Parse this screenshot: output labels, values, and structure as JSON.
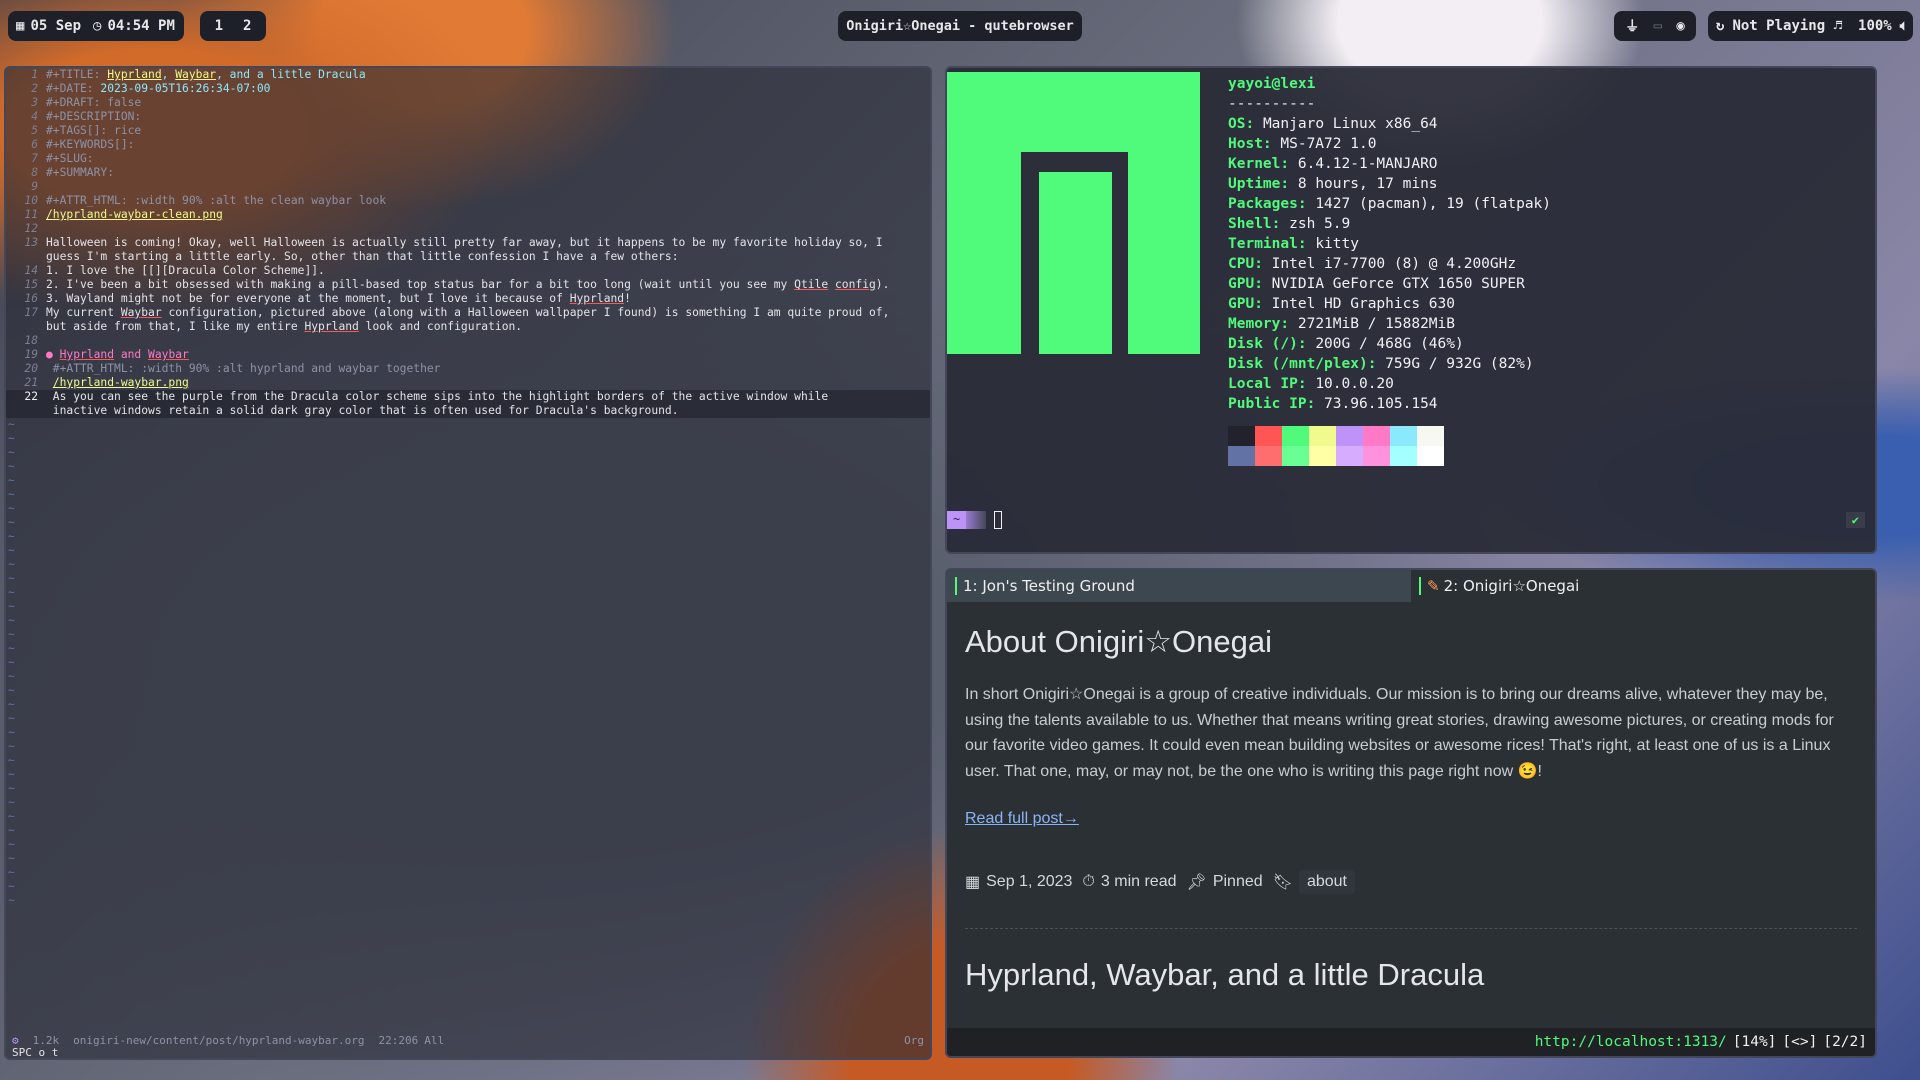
{
  "topbar": {
    "date": "05 Sep",
    "time": "04:54 PM",
    "workspaces": [
      "1",
      "2"
    ],
    "window_title": "Onigiri☆Onegai - qutebrowser",
    "media": "Not Playing ♬",
    "volume": "100%"
  },
  "editor": {
    "lines": [
      {
        "n": "1",
        "parts": [
          [
            "kw",
            "#+TITLE: "
          ],
          [
            "link",
            "Hyprland"
          ],
          [
            "val",
            ", "
          ],
          [
            "link",
            "Waybar"
          ],
          [
            "val",
            ", and a little Dracula"
          ]
        ]
      },
      {
        "n": "2",
        "parts": [
          [
            "kw",
            "#+DATE: "
          ],
          [
            "val",
            "2023-09-05T16:26:34-07:00"
          ]
        ]
      },
      {
        "n": "3",
        "parts": [
          [
            "kw",
            "#+DRAFT: false"
          ]
        ]
      },
      {
        "n": "4",
        "parts": [
          [
            "kw",
            "#+DESCRIPTION:"
          ]
        ]
      },
      {
        "n": "5",
        "parts": [
          [
            "kw",
            "#+TAGS[]: rice"
          ]
        ]
      },
      {
        "n": "6",
        "parts": [
          [
            "kw",
            "#+KEYWORDS[]:"
          ]
        ]
      },
      {
        "n": "7",
        "parts": [
          [
            "kw",
            "#+SLUG:"
          ]
        ]
      },
      {
        "n": "8",
        "parts": [
          [
            "kw",
            "#+SUMMARY:"
          ]
        ]
      },
      {
        "n": "9",
        "parts": []
      },
      {
        "n": "10",
        "parts": [
          [
            "kw",
            "#+ATTR_HTML: :width 90% :alt the clean waybar look"
          ]
        ]
      },
      {
        "n": "11",
        "parts": [
          [
            "link",
            "/hyprland-waybar-clean.png"
          ]
        ]
      },
      {
        "n": "12",
        "parts": []
      },
      {
        "n": "13",
        "parts": [
          [
            "t",
            "Halloween is coming! Okay, well Halloween is actually still pretty far away, but it happens to be my favorite holiday so, I"
          ]
        ]
      },
      {
        "n": "",
        "parts": [
          [
            "t",
            "guess I'm starting a little early. So, other than that little confession I have a few others:"
          ]
        ]
      },
      {
        "n": "14",
        "parts": [
          [
            "t",
            "1. I love the [[][Dracula Color Scheme]]."
          ]
        ]
      },
      {
        "n": "15",
        "parts": [
          [
            "t",
            "2. I've been a bit obsessed with making a pill-based top status bar for a bit too long (wait until you see my "
          ],
          [
            "under",
            "Qtile"
          ],
          [
            "t",
            " "
          ],
          [
            "under",
            "config"
          ],
          [
            "t",
            ")."
          ]
        ]
      },
      {
        "n": "16",
        "parts": [
          [
            "t",
            "3. Wayland might not be for everyone at the moment, but I love it because of "
          ],
          [
            "under",
            "Hyprland"
          ],
          [
            "t",
            "!"
          ]
        ]
      },
      {
        "n": "17",
        "parts": [
          [
            "t",
            "My current "
          ],
          [
            "under",
            "Waybar"
          ],
          [
            "t",
            " configuration, pictured above (along with a Halloween wallpaper I found) is something I am quite proud of,"
          ]
        ]
      },
      {
        "n": "",
        "parts": [
          [
            "t",
            "but aside from that, I like my entire "
          ],
          [
            "under",
            "Hyprland"
          ],
          [
            "t",
            " look and configuration."
          ]
        ]
      },
      {
        "n": "18",
        "parts": []
      },
      {
        "n": "19",
        "parts": [
          [
            "head",
            "● "
          ],
          [
            "headu",
            "Hyprland"
          ],
          [
            "head",
            " and "
          ],
          [
            "headu",
            "Waybar"
          ]
        ]
      },
      {
        "n": "20",
        "parts": [
          [
            "kw",
            " #+ATTR_HTML: :width 90% :alt hyprland and waybar together"
          ]
        ]
      },
      {
        "n": "21",
        "parts": [
          [
            "t",
            " "
          ],
          [
            "link",
            "/hyprland-waybar.png"
          ]
        ]
      },
      {
        "n": "22",
        "cur": true,
        "parts": [
          [
            "t",
            " As you can see the purple from the Dracula color scheme sips into the highlight borders of the active window while"
          ]
        ]
      },
      {
        "n": "",
        "cur": true,
        "parts": [
          [
            "t",
            " inactive windows retain a solid dark gray color that is often used for Dracula's background."
          ]
        ]
      }
    ],
    "status": {
      "size": "1.2k",
      "path": "onigiri-new/content/post/hyprland-waybar.org",
      "pos": "22:206",
      "scroll": "All",
      "mode": "Org",
      "cmd": "SPC o t"
    }
  },
  "fetch": {
    "user": "yayoi@lexi",
    "sep": "----------",
    "rows": [
      [
        "OS",
        "Manjaro Linux x86_64"
      ],
      [
        "Host",
        "MS-7A72 1.0"
      ],
      [
        "Kernel",
        "6.4.12-1-MANJARO"
      ],
      [
        "Uptime",
        "8 hours, 17 mins"
      ],
      [
        "Packages",
        "1427 (pacman), 19 (flatpak)"
      ],
      [
        "Shell",
        "zsh 5.9"
      ],
      [
        "Terminal",
        "kitty"
      ],
      [
        "CPU",
        "Intel i7-7700 (8) @ 4.200GHz"
      ],
      [
        "GPU",
        "NVIDIA GeForce GTX 1650 SUPER"
      ],
      [
        "GPU",
        "Intel HD Graphics 630"
      ],
      [
        "Memory",
        "2721MiB / 15882MiB"
      ],
      [
        "Disk (/)",
        "200G / 468G (46%)"
      ],
      [
        "Disk (/mnt/plex)",
        "759G / 932G (82%)"
      ],
      [
        "Local IP",
        "10.0.0.20"
      ],
      [
        "Public IP",
        "73.96.105.154"
      ]
    ],
    "palette_top": [
      "#21222c",
      "#ff5555",
      "#50fa7b",
      "#f1fa8c",
      "#bd93f9",
      "#ff79c6",
      "#8be9fd",
      "#f8f8f2"
    ],
    "palette_bottom": [
      "#6272a4",
      "#ff6e6e",
      "#69ff94",
      "#ffffa5",
      "#d6acff",
      "#ff92df",
      "#a4ffff",
      "#ffffff"
    ],
    "prompt_icon": "~",
    "check": "✔"
  },
  "browser": {
    "tab1": "1: Jon's Testing Ground",
    "tab2": "2: Onigiri☆Onegai",
    "title": "About Onigiri☆Onegai",
    "body": "In short Onigiri☆Onegai is a group of creative individuals. Our mission is to bring our dreams alive, whatever they may be, using the talents available to us. Whether that means writing great stories, drawing awesome pictures, or creating mods for our favorite video games. It could even mean building websites or awesome rices! That's right, at least one of us is a Linux user. That one, may, or may not, be the one who is writing this page right now 😉!",
    "read_more": "Read full post→",
    "date": "Sep 1, 2023",
    "read_time": "3 min read",
    "pinned": "Pinned",
    "tag": "about",
    "next_title": "Hyprland, Waybar, and a little Dracula",
    "status_url": "http://localhost:1313/",
    "status_pct": "[14%]",
    "status_nav": "[<>]",
    "status_tabs": "[2/2]"
  },
  "colors": {
    "accent_green": "#50fa7b",
    "dracula_purple": "#bd93f9",
    "bg": "#282a36"
  }
}
